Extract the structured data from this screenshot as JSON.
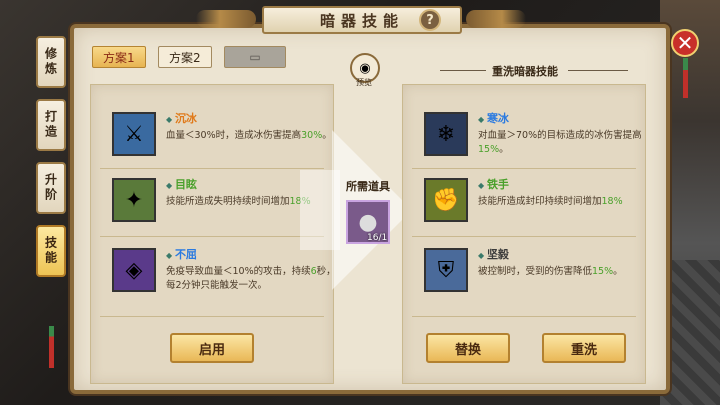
{
  "title": "暗器技能",
  "help_icon": "?",
  "close_icon": "✕",
  "sidebar": {
    "tabs": [
      {
        "label": "修炼",
        "active": false
      },
      {
        "label": "打造",
        "active": false
      },
      {
        "label": "升阶",
        "active": false
      },
      {
        "label": "技能",
        "active": true
      }
    ]
  },
  "schemes": [
    {
      "label": "方案1",
      "active": true
    },
    {
      "label": "方案2",
      "active": false
    },
    {
      "label": "",
      "locked": true
    }
  ],
  "preview": {
    "label": "预览",
    "icon": "eye-icon"
  },
  "current_skills": [
    {
      "name": "沉冰",
      "name_color": "#e07a1a",
      "text_a": "血量＜30%时，造成冰伤害提高",
      "hl": "30%",
      "text_b": "。",
      "icon": "ice-blade-icon",
      "bg": "#3a6aa0"
    },
    {
      "name": "目眩",
      "name_color": "#4aa02a",
      "text_a": "技能所造成失明持续时间增加",
      "hl": "18%",
      "text_b": "",
      "icon": "daze-icon",
      "bg": "#5a7a3a"
    },
    {
      "name": "不屈",
      "name_color": "#2a7ae0",
      "text_a": "免疫导致血量＜10%的攻击，持续",
      "hl": "6",
      "text_b": "秒，每2分钟只能触发一次。",
      "icon": "unyielding-icon",
      "bg": "#5a3a8a"
    }
  ],
  "required": {
    "label": "所需道具",
    "count": "16/1",
    "icon": "token-icon"
  },
  "reroll_title": "重洗暗器技能",
  "new_skills": [
    {
      "name": "寒冰",
      "name_color": "#2a7ae0",
      "text_a": "对血量＞70%的目标造成的冰伤害提高",
      "hl": "15%",
      "text_b": "。",
      "icon": "frost-icon",
      "bg": "#2a3a5a"
    },
    {
      "name": "铁手",
      "name_color": "#4aa02a",
      "text_a": "技能所造成封印持续时间增加",
      "hl": "18%",
      "text_b": "",
      "icon": "iron-hand-icon",
      "bg": "#6a7a2a"
    },
    {
      "name": "坚毅",
      "name_color": "#3a3a3a",
      "text_a": "被控制时，受到的伤害降低",
      "hl": "15%",
      "text_b": "。",
      "icon": "resolve-icon",
      "bg": "#4a6a9a"
    }
  ],
  "buttons": {
    "enable": "启用",
    "replace": "替换",
    "reroll": "重洗"
  }
}
